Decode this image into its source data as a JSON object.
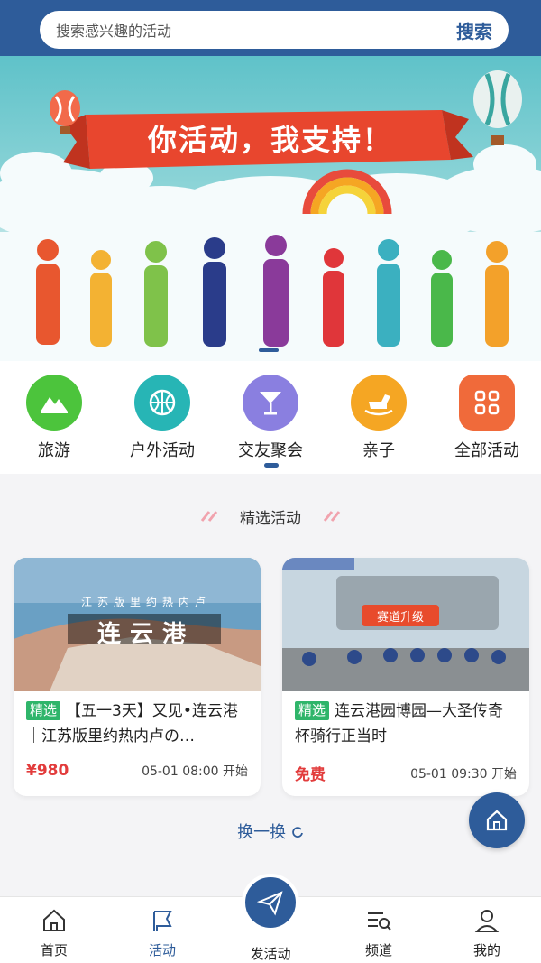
{
  "search": {
    "placeholder": "搜索感兴趣的活动",
    "button": "搜索"
  },
  "banner": {
    "slogan": "你活动，我支持！"
  },
  "categories": [
    {
      "label": "旅游",
      "icon": "mountain-icon",
      "color": "#4cc43c"
    },
    {
      "label": "户外活动",
      "icon": "basketball-icon",
      "color": "#27b5b5"
    },
    {
      "label": "交友聚会",
      "icon": "cocktail-icon",
      "color": "#8a7fe0"
    },
    {
      "label": "亲子",
      "icon": "rocking-horse-icon",
      "color": "#f5a623"
    },
    {
      "label": "全部活动",
      "icon": "grid-icon",
      "color": "#f06a3a"
    }
  ],
  "featured": {
    "title": "精选活动",
    "cards": [
      {
        "tag": "精选",
        "title": "【五一3天】又见•连云港｜江苏版里约热内卢の…",
        "price": "¥980",
        "time": "05-01 08:00 开始",
        "image_caption": "连云港",
        "image_subcaption": "江苏版里约热内卢"
      },
      {
        "tag": "精选",
        "title": "连云港园博园—大圣传奇杯骑行正当时",
        "price": "免费",
        "time": "05-01 09:30 开始",
        "image_caption": "赛道升级"
      }
    ],
    "refresh": "换一换"
  },
  "nav": {
    "items": [
      {
        "label": "首页",
        "icon": "home-icon"
      },
      {
        "label": "活动",
        "icon": "flag-icon"
      },
      {
        "label": "发活动",
        "icon": "paper-plane-icon"
      },
      {
        "label": "频道",
        "icon": "channel-icon"
      },
      {
        "label": "我的",
        "icon": "user-icon"
      }
    ],
    "active": "活动"
  },
  "colors": {
    "primary": "#2e5c9a",
    "price": "#e23c3c",
    "tag": "#2fb56a"
  }
}
